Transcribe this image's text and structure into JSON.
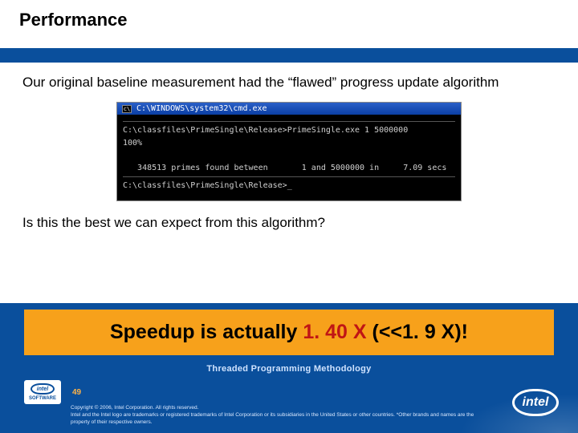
{
  "header": {
    "title": "Performance"
  },
  "body": {
    "para1": "Our original baseline measurement had the “flawed” progress update algorithm",
    "para2": "Is this the best we can expect from this algorithm?"
  },
  "console": {
    "title": "C:\\WINDOWS\\system32\\cmd.exe",
    "line1": "C:\\classfiles\\PrimeSingle\\Release>PrimeSingle.exe 1 5000000",
    "line2": "100%",
    "line3": "   348513 primes found between       1 and 5000000 in     7.09 secs",
    "line4": "C:\\classfiles\\PrimeSingle\\Release>_"
  },
  "callout": {
    "pre": "Speedup is actually ",
    "value": "1. 40 X",
    "post": " (<<1. 9 X)!"
  },
  "footer": {
    "methodology": "Threaded Programming Methodology",
    "page": "49",
    "software_label": "SOFTWARE",
    "brand": "intel",
    "copyright": "Copyright © 2006, Intel Corporation. All rights reserved.",
    "trademark": "Intel and the Intel logo are trademarks or registered trademarks of Intel Corporation or its subsidiaries in the United States or other countries. *Other brands and names are the property of their respective owners."
  }
}
